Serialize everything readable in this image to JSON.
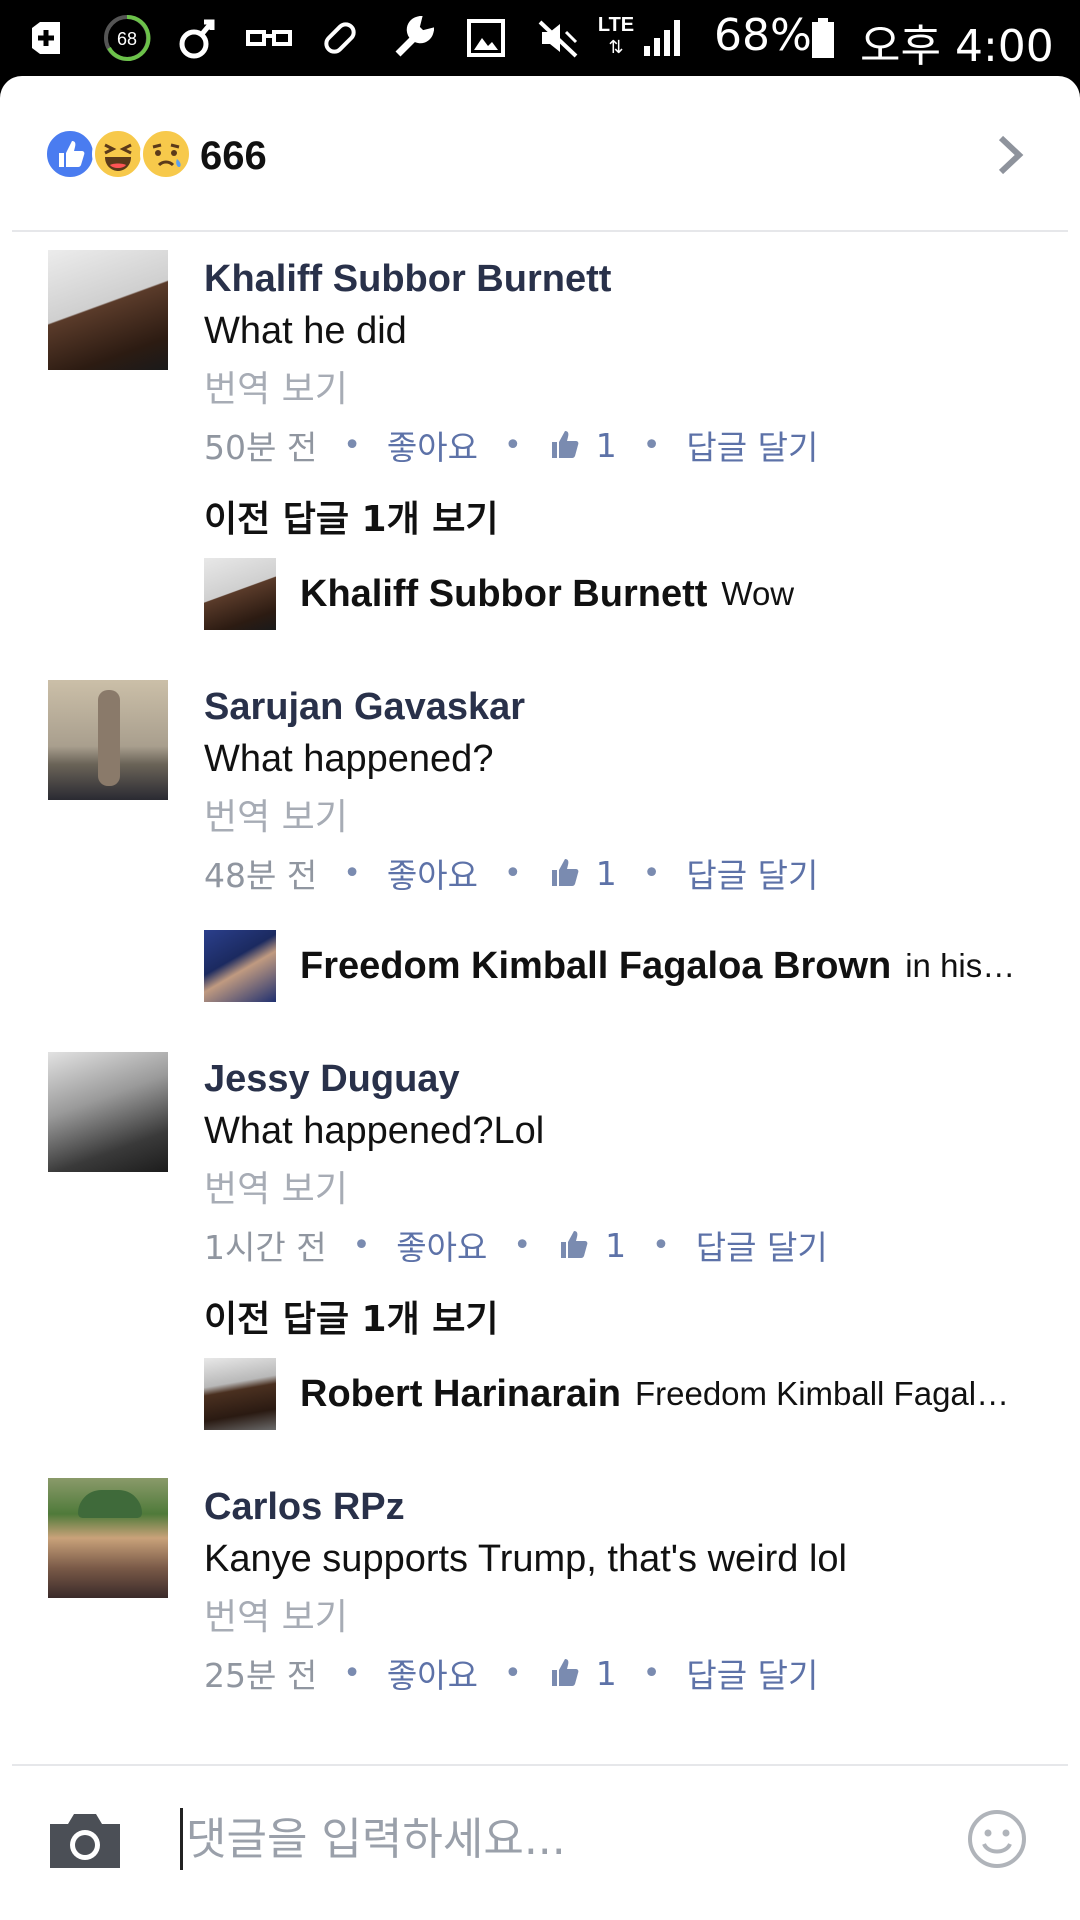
{
  "status_bar": {
    "battery_ring": "68",
    "network": "LTE",
    "battery_percent": "68%",
    "time": "오후 4:00",
    "icons": [
      "add-box-icon",
      "battery-ring-icon",
      "male-symbol-icon",
      "glasses-icon",
      "bandage-icon",
      "wrench-icon",
      "image-icon",
      "mute-icon",
      "lte-icon",
      "signal-icon",
      "battery-icon"
    ]
  },
  "reactions": {
    "emojis": [
      "like-reaction-icon",
      "haha-reaction-icon",
      "sad-reaction-icon"
    ],
    "count": "666",
    "colors": {
      "like": "#4a7cf0",
      "emoji_yellow": "#f7c94b"
    }
  },
  "comments": [
    {
      "author": "Khaliff Subbor Burnett",
      "text": "What he did",
      "translate": "번역 보기",
      "time": "50분 전",
      "like_label": "좋아요",
      "like_count": "1",
      "reply_label": "답글 달기",
      "prev_replies": "이전 답글 1개 보기",
      "reply": {
        "author": "Khaliff Subbor Burnett",
        "text": "Wow"
      }
    },
    {
      "author": "Sarujan Gavaskar",
      "text": "What happened?",
      "translate": "번역 보기",
      "time": "48분 전",
      "like_label": "좋아요",
      "like_count": "1",
      "reply_label": "답글 달기",
      "reply": {
        "author": "Freedom Kimball Fagaloa Brown",
        "text": "in his…"
      }
    },
    {
      "author": "Jessy Duguay",
      "text": "What happened?Lol",
      "translate": "번역 보기",
      "time": "1시간 전",
      "like_label": "좋아요",
      "like_count": "1",
      "reply_label": "답글 달기",
      "prev_replies": "이전 답글 1개 보기",
      "reply": {
        "author": "Robert Harinarain",
        "text": "Freedom Kimball Fagal…"
      }
    },
    {
      "author": "Carlos RPz",
      "text": "Kanye supports Trump, that's weird  lol",
      "translate": "번역 보기",
      "time": "25분 전",
      "like_label": "좋아요",
      "like_count": "1",
      "reply_label": "답글 달기"
    }
  ],
  "composer": {
    "placeholder": "댓글을 입력하세요...",
    "camera_icon": "camera-icon",
    "emoji_icon": "smiley-icon"
  }
}
